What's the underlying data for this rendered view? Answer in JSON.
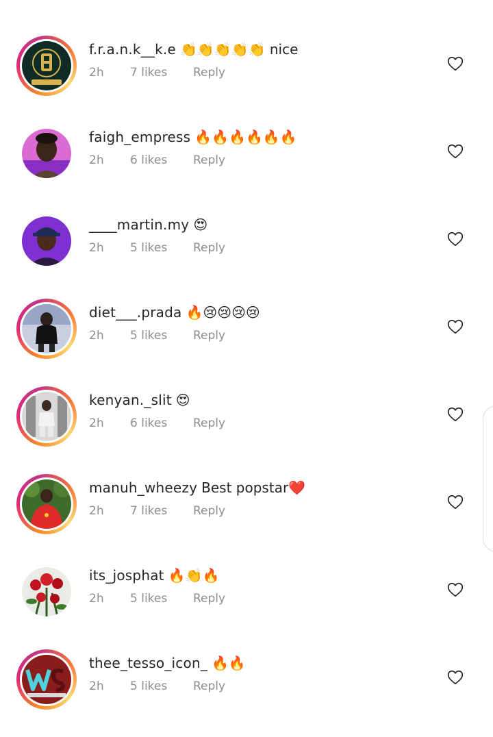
{
  "comments": [
    {
      "username": "f.r.a.n.k__k.e",
      "text": "👏👏👏👏👏 nice",
      "time": "2h",
      "likes": "7 likes",
      "reply": "Reply",
      "story": true,
      "avatar": "brand-logo"
    },
    {
      "username": "faigh_empress",
      "text": "🔥🔥🔥🔥🔥🔥",
      "time": "2h",
      "likes": "6 likes",
      "reply": "Reply",
      "story": false,
      "avatar": "person-pink"
    },
    {
      "username": "____martin.my",
      "text": "😍",
      "time": "2h",
      "likes": "5 likes",
      "reply": "Reply",
      "story": false,
      "avatar": "person-purple"
    },
    {
      "username": "diet___.prada",
      "text": "🔥😢😢😢😢",
      "time": "2h",
      "likes": "5 likes",
      "reply": "Reply",
      "story": true,
      "avatar": "person-dark"
    },
    {
      "username": "kenyan._slit",
      "text": "😍",
      "time": "2h",
      "likes": "6 likes",
      "reply": "Reply",
      "story": true,
      "avatar": "person-gray"
    },
    {
      "username": "manuh_wheezy",
      "text": "Best popstar❤️",
      "time": "2h",
      "likes": "7 likes",
      "reply": "Reply",
      "story": true,
      "avatar": "person-red"
    },
    {
      "username": "its_josphat",
      "text": "🔥👏🔥",
      "time": "2h",
      "likes": "5 likes",
      "reply": "Reply",
      "story": false,
      "avatar": "flowers"
    },
    {
      "username": "thee_tesso_icon_",
      "text": "🔥🔥",
      "time": "2h",
      "likes": "5 likes",
      "reply": "Reply",
      "story": true,
      "avatar": "ws-logo"
    }
  ],
  "colors": {
    "username": "#262626",
    "meta": "#8e8e8e",
    "heart_outline": "#262626",
    "story_ring": "#dd2a7b"
  },
  "icons": {
    "like": "heart-outline-icon"
  }
}
